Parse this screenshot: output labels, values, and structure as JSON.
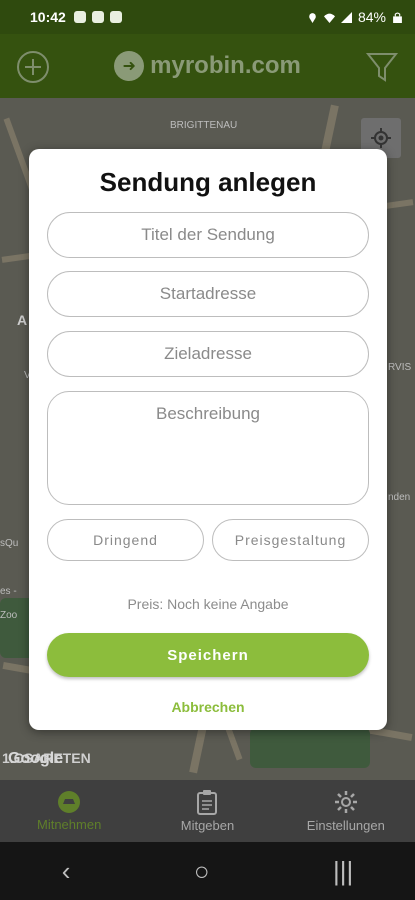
{
  "status_bar": {
    "time": "10:42",
    "battery": "84%"
  },
  "header": {
    "logo_text": "myrobin.com",
    "add_icon": "plus-circle-icon",
    "filter_icon": "filter-icon"
  },
  "map": {
    "labels": [
      "BRIGITTENAU",
      "A",
      "V",
      "RVIS",
      "nden",
      "sQu",
      "es -",
      "Zoo",
      "1.CSARETEN"
    ],
    "attribution": "Google"
  },
  "dialog": {
    "title": "Sendung anlegen",
    "title_placeholder": "Titel der Sendung",
    "start_placeholder": "Startadresse",
    "destination_placeholder": "Zieladresse",
    "description_placeholder": "Beschreibung",
    "urgent_label": "Dringend",
    "pricing_label": "Preisgestaltung",
    "price_text": "Preis: Noch keine Angabe",
    "save_label": "Speichern",
    "cancel_label": "Abbrechen"
  },
  "bottom_nav": {
    "items": [
      {
        "label": "Mitnehmen",
        "icon": "car-icon",
        "active": true
      },
      {
        "label": "Mitgeben",
        "icon": "clipboard-icon",
        "active": false
      },
      {
        "label": "Einstellungen",
        "icon": "gear-icon",
        "active": false
      }
    ]
  },
  "colors": {
    "accent": "#8cbd3c",
    "header": "#35520f"
  }
}
